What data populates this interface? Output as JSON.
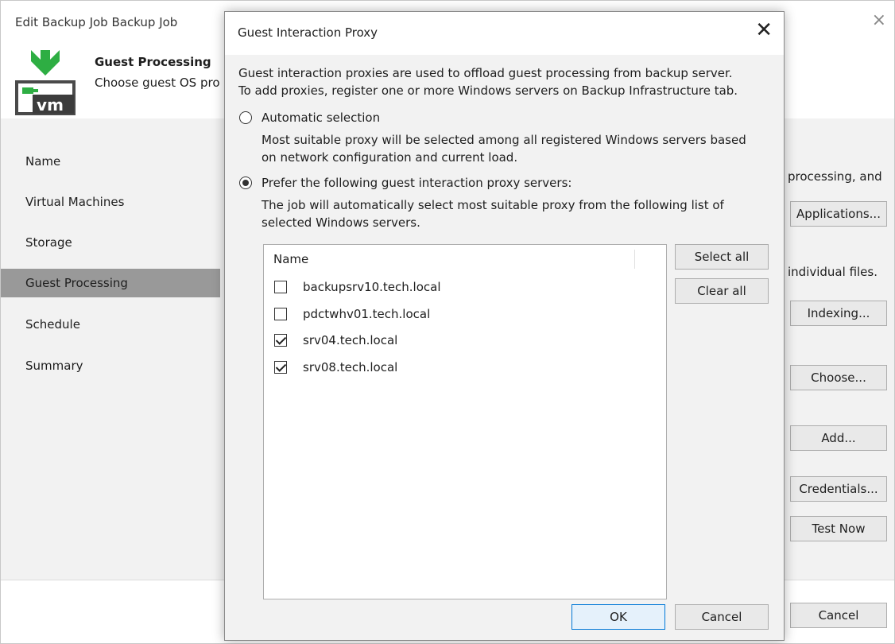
{
  "main": {
    "title": "Edit Backup Job Backup Job",
    "close_glyph": "×",
    "header": {
      "title": "Guest Processing",
      "subtitle": "Choose guest OS pro",
      "icon": "vm-download-icon",
      "icon_text": "vm"
    },
    "nav": [
      {
        "label": "Name"
      },
      {
        "label": "Virtual Machines"
      },
      {
        "label": "Storage"
      },
      {
        "label": "Guest Processing"
      },
      {
        "label": "Schedule"
      },
      {
        "label": "Summary"
      }
    ],
    "active_nav": "Guest Processing",
    "right_texts": {
      "text1": "processing, and",
      "text2": "individual files."
    },
    "buttons": {
      "applications": "Applications...",
      "indexing": "Indexing...",
      "choose": "Choose...",
      "add": "Add...",
      "credentials": "Credentials...",
      "test_now": "Test Now",
      "cancel": "Cancel"
    }
  },
  "dialog": {
    "title": "Guest Interaction Proxy",
    "close_glyph": "✕",
    "description_line1": "Guest interaction proxies are used to offload guest processing from backup server.",
    "description_line2": "To add proxies, register one or more Windows servers on Backup Infrastructure tab.",
    "auto_option": {
      "label": "Automatic selection",
      "checked": false,
      "note_line1": "Most suitable proxy will be selected among all registered Windows servers based",
      "note_line2": "on network configuration and current load."
    },
    "prefer_option": {
      "label": "Prefer the following guest interaction proxy servers:",
      "checked": true,
      "note_line1": "The job will automatically select most suitable proxy from the following list of",
      "note_line2": "selected Windows servers."
    },
    "list": {
      "column": "Name",
      "rows": [
        {
          "label": "backupsrv10.tech.local",
          "checked": false
        },
        {
          "label": "pdctwhv01.tech.local",
          "checked": false
        },
        {
          "label": "srv04.tech.local",
          "checked": true
        },
        {
          "label": "srv08.tech.local",
          "checked": true
        }
      ]
    },
    "buttons": {
      "select_all": "Select all",
      "clear_all": "Clear all",
      "ok": "OK",
      "cancel": "Cancel"
    }
  },
  "colors": {
    "accent": "#0078d7",
    "nav_active": "#999999",
    "icon_green": "#2eae43",
    "icon_dark": "#3c3c3c"
  }
}
